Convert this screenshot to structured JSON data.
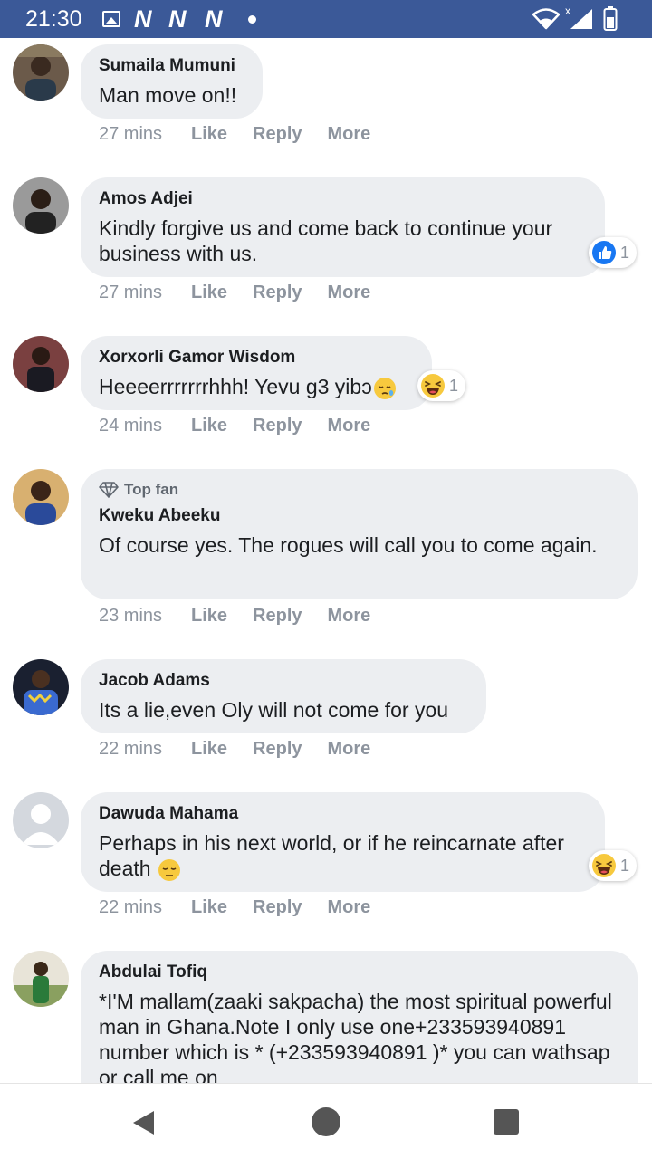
{
  "status_bar": {
    "time": "21:30",
    "notification_icons": [
      "image-icon",
      "n-icon",
      "n-icon",
      "n-icon"
    ],
    "right_icons": [
      "wifi-icon",
      "signal-icon",
      "battery-icon"
    ]
  },
  "comments": [
    {
      "author": "Sumaila Mumuni",
      "text": "Man move on!!",
      "time": "27 mins"
    },
    {
      "author": "Amos Adjei",
      "text": "Kindly forgive us and come back to continue your business with us.",
      "time": "27 mins",
      "reaction": {
        "type": "like",
        "count": "1"
      }
    },
    {
      "author": "Xorxorli Gamor Wisdom",
      "text": "Heeeerrrrrrrhhh! Yevu g3 yibɔ",
      "emoji": "😪",
      "time": "24 mins",
      "reaction": {
        "type": "haha",
        "count": "1"
      }
    },
    {
      "badge": "Top fan",
      "author": "Kweku Abeeku",
      "text": "Of course yes. The rogues will call you to come again.",
      "time": "23 mins"
    },
    {
      "author": "Jacob Adams",
      "text": "Its a lie,even Oly will not come for you",
      "time": "22 mins"
    },
    {
      "author": "Dawuda Mahama",
      "text": "Perhaps in his next world, or if he reincarnate after death",
      "emoji": "😔",
      "time": "22 mins",
      "reaction": {
        "type": "haha",
        "count": "1"
      }
    },
    {
      "author": "Abdulai Tofiq",
      "text": "*I'M mallam(zaaki sakpacha) the most spiritual powerful man in Ghana.Note I only use one+233593940891 number which is * (+233593940891 )* you can wathsap or call me on"
    }
  ],
  "actions": {
    "like": "Like",
    "reply": "Reply",
    "more": "More"
  },
  "colors": {
    "status_bar": "#3b5998",
    "bubble": "#eceef1",
    "meta_text": "#8d949e",
    "like_blue": "#1877f2",
    "haha_yellow": "#f7c93e"
  },
  "nav": [
    "back-icon",
    "home-icon",
    "recents-icon"
  ]
}
